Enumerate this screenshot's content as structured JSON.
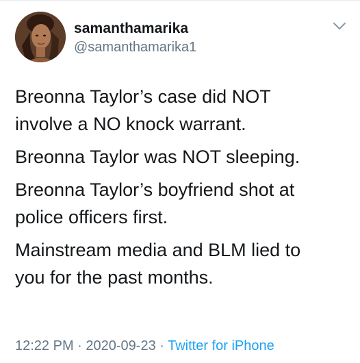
{
  "user": {
    "display_name": "samanthamarika",
    "handle": "@samanthamarika1"
  },
  "tweet": {
    "paragraphs": [
      "Breonna Taylor’s case did NOT\ninvolve a NO knock warrant.",
      "Breonna Taylor was NOT sleeping.",
      "Breonna Taylor’s boyfriend shot at\npolice officers first.",
      "Mainstream media and BLM lied to\nyou for the past months."
    ]
  },
  "meta": {
    "time": "12:22 PM",
    "separator": " · ",
    "date": "2020-09-23",
    "source": "Twitter for iPhone"
  },
  "icons": {
    "menu": "chevron-down-icon",
    "avatar": "avatar"
  },
  "colors": {
    "text": "#14171a",
    "secondary": "#657786",
    "link": "#1da1f2"
  }
}
